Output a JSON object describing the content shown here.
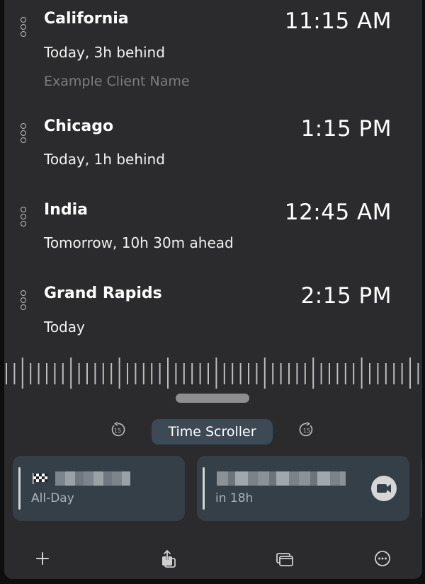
{
  "clocks": [
    {
      "city": "California",
      "relative": "Today, 3h behind",
      "note": "Example Client Name",
      "time": "11:15 AM"
    },
    {
      "city": "Chicago",
      "relative": "Today, 1h behind",
      "time": "1:15 PM"
    },
    {
      "city": "India",
      "relative": "Tomorrow, 10h 30m ahead",
      "time": "12:45 AM"
    },
    {
      "city": "Grand Rapids",
      "relative": "Today",
      "time": "2:15 PM"
    }
  ],
  "scroller": {
    "label": "Time Scroller",
    "back_label": "15",
    "forward_label": "15"
  },
  "events": [
    {
      "icon": "checkered-flag-icon",
      "title": "",
      "meta": "All-Day"
    },
    {
      "icon": "video-camera-icon",
      "title": "",
      "meta": "in 18h"
    }
  ],
  "toolbar": [
    "plus-icon",
    "share-icon",
    "windows-icon",
    "more-icon"
  ],
  "colors": {
    "panel": "#2b2b2d",
    "pill": "#3b4a55",
    "card": "#343f48",
    "text": "#ffffff",
    "muted": "#7d7d80"
  }
}
